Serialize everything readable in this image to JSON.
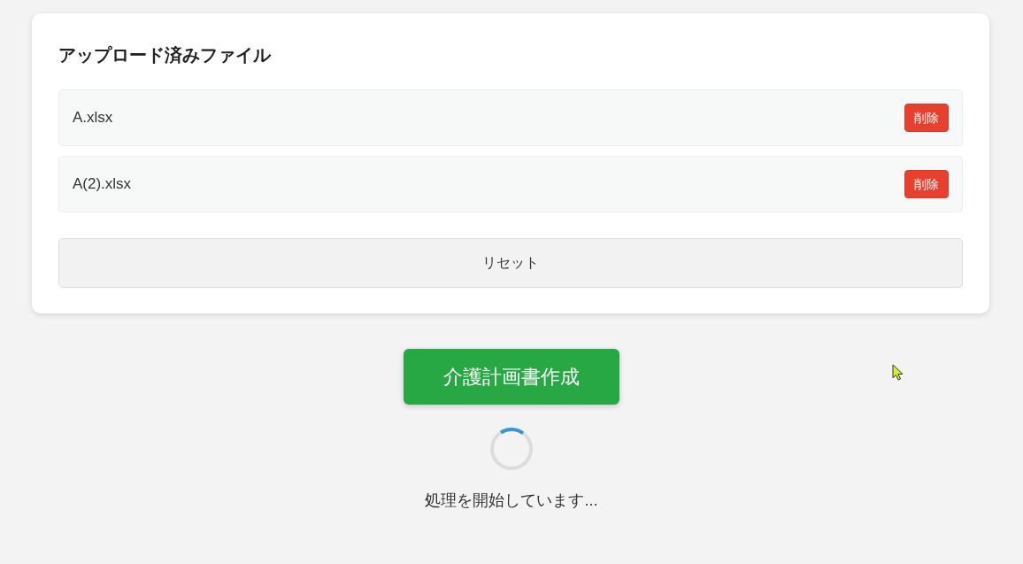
{
  "uploaded_files": {
    "title": "アップロード済みファイル",
    "files": [
      {
        "name": "A.xlsx",
        "delete_button": "削除"
      },
      {
        "name": "A(2).xlsx",
        "delete_button": "削除"
      }
    ],
    "reset_button": "リセット"
  },
  "create_button": "介護計画書作成",
  "status": {
    "loading": true,
    "message": "処理を開始しています..."
  }
}
